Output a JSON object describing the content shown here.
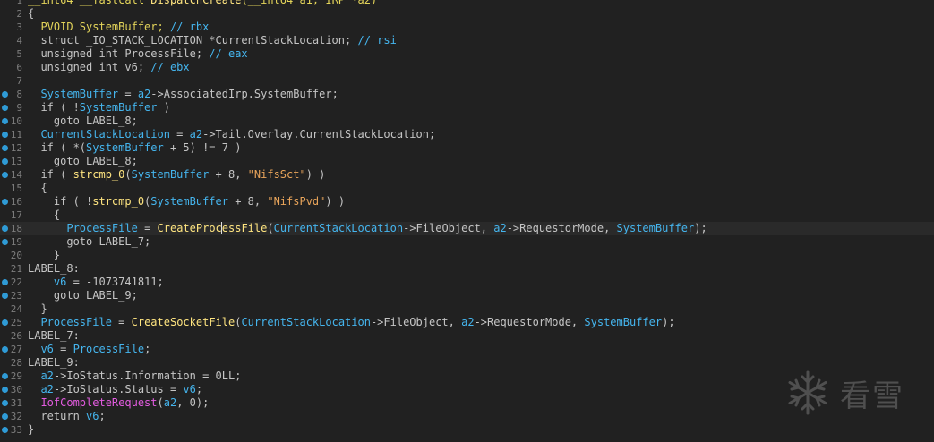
{
  "watermark": {
    "text": "看雪",
    "icon": "snowflake-icon"
  },
  "colors": {
    "background": "#212121",
    "highlight_line": "#2a2a2a",
    "cursor": "#e0e0e0",
    "marker_dot": "#2f9bd6"
  },
  "editor": {
    "cursor_line": 18,
    "lines": [
      {
        "n": "1",
        "dot": false,
        "tokens": [
          [
            "__int64 __fastcall ",
            "y"
          ],
          [
            "DispatchCreate",
            "f"
          ],
          [
            "(__int64 a1, IRP *a2)",
            "y"
          ]
        ]
      },
      {
        "n": "2",
        "dot": false,
        "tokens": [
          [
            "{",
            "p"
          ]
        ]
      },
      {
        "n": "3",
        "dot": false,
        "tokens": [
          [
            "  ",
            "p"
          ],
          [
            "PVOID SystemBuffer; ",
            "y"
          ],
          [
            "// rbx",
            "c"
          ]
        ]
      },
      {
        "n": "4",
        "dot": false,
        "tokens": [
          [
            "  struct _IO_STACK_LOCATION *CurrentStackLocation; ",
            "k"
          ],
          [
            "// rsi",
            "c"
          ]
        ]
      },
      {
        "n": "5",
        "dot": false,
        "tokens": [
          [
            "  unsigned int ProcessFile; ",
            "k"
          ],
          [
            "// eax",
            "c"
          ]
        ]
      },
      {
        "n": "6",
        "dot": false,
        "tokens": [
          [
            "  unsigned int v6; ",
            "k"
          ],
          [
            "// ebx",
            "c"
          ]
        ]
      },
      {
        "n": "7",
        "dot": false,
        "tokens": [
          [
            "",
            "p"
          ]
        ]
      },
      {
        "n": "8",
        "dot": true,
        "tokens": [
          [
            "  ",
            "p"
          ],
          [
            "SystemBuffer",
            "c"
          ],
          [
            " = ",
            "p"
          ],
          [
            "a2",
            "c"
          ],
          [
            "->AssociatedIrp.SystemBuffer;",
            "p"
          ]
        ]
      },
      {
        "n": "9",
        "dot": true,
        "tokens": [
          [
            "  if ( !",
            "p"
          ],
          [
            "SystemBuffer",
            "c"
          ],
          [
            " )",
            "p"
          ]
        ]
      },
      {
        "n": "10",
        "dot": true,
        "tokens": [
          [
            "    goto LABEL_8;",
            "p"
          ]
        ]
      },
      {
        "n": "11",
        "dot": true,
        "tokens": [
          [
            "  ",
            "p"
          ],
          [
            "CurrentStackLocation",
            "c"
          ],
          [
            " = ",
            "p"
          ],
          [
            "a2",
            "c"
          ],
          [
            "->Tail.Overlay.CurrentStackLocation;",
            "p"
          ]
        ]
      },
      {
        "n": "12",
        "dot": true,
        "tokens": [
          [
            "  if ( *(",
            "p"
          ],
          [
            "SystemBuffer",
            "c"
          ],
          [
            " + 5) != 7 )",
            "p"
          ]
        ]
      },
      {
        "n": "13",
        "dot": true,
        "tokens": [
          [
            "    goto LABEL_8;",
            "p"
          ]
        ]
      },
      {
        "n": "14",
        "dot": true,
        "tokens": [
          [
            "  if ( ",
            "p"
          ],
          [
            "strcmp_0",
            "f"
          ],
          [
            "(",
            "p"
          ],
          [
            "SystemBuffer",
            "c"
          ],
          [
            " + 8, ",
            "p"
          ],
          [
            "\"NifsSct\"",
            "s"
          ],
          [
            ") )",
            "p"
          ]
        ]
      },
      {
        "n": "15",
        "dot": false,
        "tokens": [
          [
            "  {",
            "p"
          ]
        ]
      },
      {
        "n": "16",
        "dot": true,
        "tokens": [
          [
            "    if ( !",
            "p"
          ],
          [
            "strcmp_0",
            "f"
          ],
          [
            "(",
            "p"
          ],
          [
            "SystemBuffer",
            "c"
          ],
          [
            " + 8, ",
            "p"
          ],
          [
            "\"NifsPvd\"",
            "s"
          ],
          [
            ") )",
            "p"
          ]
        ]
      },
      {
        "n": "17",
        "dot": false,
        "tokens": [
          [
            "    {",
            "p"
          ]
        ]
      },
      {
        "n": "18",
        "dot": true,
        "hl": true,
        "tokens": [
          [
            "      ",
            "p"
          ],
          [
            "ProcessFile",
            "c"
          ],
          [
            " = ",
            "p"
          ],
          [
            "CreateProc",
            "f"
          ],
          [
            "|",
            ""
          ],
          [
            "essFile",
            "f"
          ],
          [
            "(",
            "p"
          ],
          [
            "CurrentStackLocation",
            "c"
          ],
          [
            "->FileObject, ",
            "p"
          ],
          [
            "a2",
            "c"
          ],
          [
            "->RequestorMode, ",
            "p"
          ],
          [
            "SystemBuffer",
            "c"
          ],
          [
            ");",
            "p"
          ]
        ]
      },
      {
        "n": "19",
        "dot": true,
        "tokens": [
          [
            "      goto LABEL_7;",
            "p"
          ]
        ]
      },
      {
        "n": "20",
        "dot": false,
        "tokens": [
          [
            "    }",
            "p"
          ]
        ]
      },
      {
        "n": "21",
        "dot": false,
        "tokens": [
          [
            "LABEL_8:",
            "p"
          ]
        ]
      },
      {
        "n": "22",
        "dot": true,
        "tokens": [
          [
            "    ",
            "p"
          ],
          [
            "v6",
            "c"
          ],
          [
            " = -1073741811;",
            "p"
          ]
        ]
      },
      {
        "n": "23",
        "dot": true,
        "tokens": [
          [
            "    goto LABEL_9;",
            "p"
          ]
        ]
      },
      {
        "n": "24",
        "dot": false,
        "tokens": [
          [
            "  }",
            "p"
          ]
        ]
      },
      {
        "n": "25",
        "dot": true,
        "tokens": [
          [
            "  ",
            "p"
          ],
          [
            "ProcessFile",
            "c"
          ],
          [
            " = ",
            "p"
          ],
          [
            "CreateSocketFile",
            "f"
          ],
          [
            "(",
            "p"
          ],
          [
            "CurrentStackLocation",
            "c"
          ],
          [
            "->FileObject, ",
            "p"
          ],
          [
            "a2",
            "c"
          ],
          [
            "->RequestorMode, ",
            "p"
          ],
          [
            "SystemBuffer",
            "c"
          ],
          [
            ");",
            "p"
          ]
        ]
      },
      {
        "n": "26",
        "dot": false,
        "tokens": [
          [
            "LABEL_7:",
            "p"
          ]
        ]
      },
      {
        "n": "27",
        "dot": true,
        "tokens": [
          [
            "  ",
            "p"
          ],
          [
            "v6",
            "c"
          ],
          [
            " = ",
            "p"
          ],
          [
            "ProcessFile",
            "c"
          ],
          [
            ";",
            "p"
          ]
        ]
      },
      {
        "n": "28",
        "dot": false,
        "tokens": [
          [
            "LABEL_9:",
            "p"
          ]
        ]
      },
      {
        "n": "29",
        "dot": true,
        "tokens": [
          [
            "  ",
            "p"
          ],
          [
            "a2",
            "c"
          ],
          [
            "->IoStatus.Information = 0LL;",
            "p"
          ]
        ]
      },
      {
        "n": "30",
        "dot": true,
        "tokens": [
          [
            "  ",
            "p"
          ],
          [
            "a2",
            "c"
          ],
          [
            "->IoStatus.Status = ",
            "p"
          ],
          [
            "v6",
            "c"
          ],
          [
            ";",
            "p"
          ]
        ]
      },
      {
        "n": "31",
        "dot": true,
        "tokens": [
          [
            "  ",
            "p"
          ],
          [
            "IofCompleteRequest",
            "m"
          ],
          [
            "(",
            "p"
          ],
          [
            "a2",
            "c"
          ],
          [
            ", 0);",
            "p"
          ]
        ]
      },
      {
        "n": "32",
        "dot": true,
        "tokens": [
          [
            "  return ",
            "p"
          ],
          [
            "v6",
            "c"
          ],
          [
            ";",
            "p"
          ]
        ]
      },
      {
        "n": "33",
        "dot": true,
        "tokens": [
          [
            "}",
            "p"
          ]
        ]
      }
    ]
  }
}
